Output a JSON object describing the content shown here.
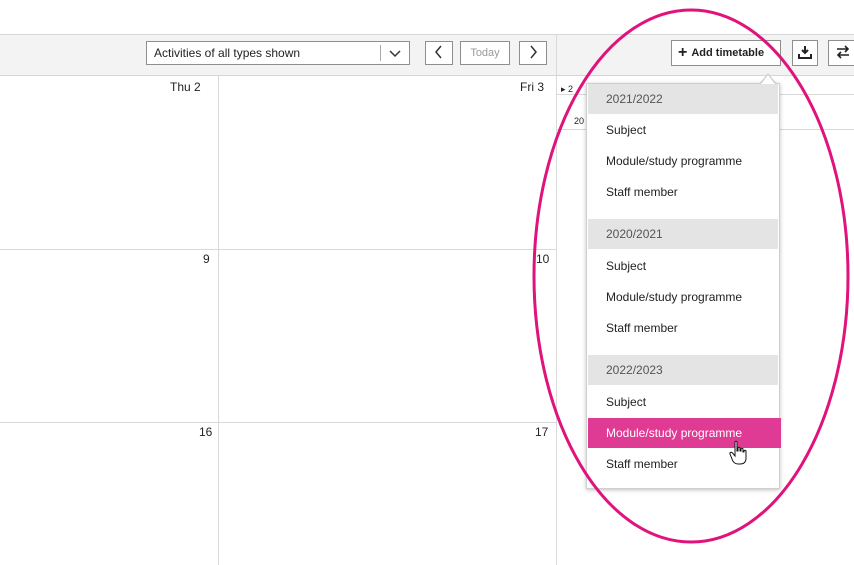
{
  "toolbar": {
    "filter_value": "Activities of all types shown",
    "prev_glyph": "‹",
    "today_label": "Today",
    "next_glyph": "›",
    "add_timetable_label": "Add timetable",
    "add_icon": "plus-icon",
    "download_icon": "download-icon",
    "swap_icon": "swap-icon"
  },
  "calendar": {
    "rows": [
      {
        "thu": "Thu 2",
        "fri": "Fri 3"
      },
      {
        "thu": "9",
        "fri": "10"
      },
      {
        "thu": "16",
        "fri": "17"
      }
    ],
    "side_peek": [
      "▸ 2",
      "20"
    ]
  },
  "dropdown": {
    "groups": [
      {
        "year": "2021/2022",
        "items": [
          "Subject",
          "Module/study programme",
          "Staff member"
        ]
      },
      {
        "year": "2020/2021",
        "items": [
          "Subject",
          "Module/study programme",
          "Staff member"
        ]
      },
      {
        "year": "2022/2023",
        "items": [
          "Subject",
          "Module/study programme",
          "Staff member"
        ]
      }
    ],
    "highlighted": "2022/2023 Module/study programme"
  },
  "colors": {
    "highlight": "#df3b94",
    "annotation": "#e0127c",
    "group_header_bg": "#e4e4e4"
  }
}
